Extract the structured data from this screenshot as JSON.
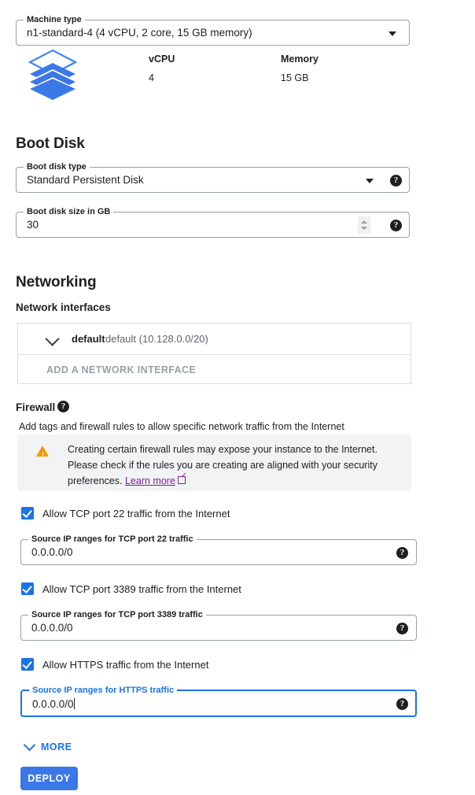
{
  "machine_type": {
    "legend": "Machine type",
    "value": "n1-standard-4 (4 vCPU, 2 core, 15 GB memory)",
    "dropdown_icon": "chevron-down-icon",
    "icon": "layers-stack-icon",
    "specs": [
      {
        "label": "vCPU",
        "value": "4"
      },
      {
        "label": "Memory",
        "value": "15 GB"
      }
    ]
  },
  "boot_disk": {
    "heading": "Boot Disk",
    "type_field": {
      "legend": "Boot disk type",
      "value": "Standard Persistent Disk",
      "help_icon": "help-icon",
      "help_glyph": "?"
    },
    "size_field": {
      "legend": "Boot disk size in GB",
      "value": "30",
      "help_icon": "help-icon",
      "help_glyph": "?",
      "stepper_icon": "spinner-stepper-icon"
    }
  },
  "networking": {
    "heading": "Networking",
    "interfaces_label": "Network interfaces",
    "interface": {
      "expand_icon": "chevron-down-icon",
      "name": "default",
      "details": "default (10.128.0.0/20)"
    },
    "add_interface_label": "ADD A NETWORK INTERFACE"
  },
  "firewall": {
    "heading": "Firewall",
    "help_glyph": "?",
    "description": "Add tags and firewall rules to allow specific network traffic from the Internet",
    "warning": {
      "icon": "warning-triangle-icon",
      "line1": "Creating certain firewall rules may expose your instance to the Internet.",
      "line2": "Please check if the rules you are creating are aligned with your security",
      "line3_prefix": "preferences. ",
      "link_text": "Learn more",
      "link_icon": "external-link-icon"
    },
    "rules": [
      {
        "checkbox_label": "Allow TCP port 22 traffic from the Internet",
        "checked": true,
        "source_legend": "Source IP ranges for TCP port 22 traffic",
        "source_value": "0.0.0.0/0",
        "help_glyph": "?",
        "focused": false
      },
      {
        "checkbox_label": "Allow TCP port 3389 traffic from the Internet",
        "checked": true,
        "source_legend": "Source IP ranges for TCP port 3389 traffic",
        "source_value": "0.0.0.0/0",
        "help_glyph": "?",
        "focused": false
      },
      {
        "checkbox_label": "Allow HTTPS traffic from the Internet",
        "checked": true,
        "source_legend": "Source IP ranges for HTTPS traffic",
        "source_value": "0.0.0.0/0",
        "help_glyph": "?",
        "focused": true
      }
    ]
  },
  "footer": {
    "more_label": "MORE",
    "more_icon": "chevron-down-icon",
    "deploy_label": "DEPLOY"
  },
  "colors": {
    "accent_blue": "#1a73e8",
    "deploy_blue": "#3b78e7",
    "warning_orange": "#f29900",
    "link_purple": "#7b1fa2",
    "panel_grey": "#f1f3f4",
    "border_grey": "#9aa0a6"
  }
}
